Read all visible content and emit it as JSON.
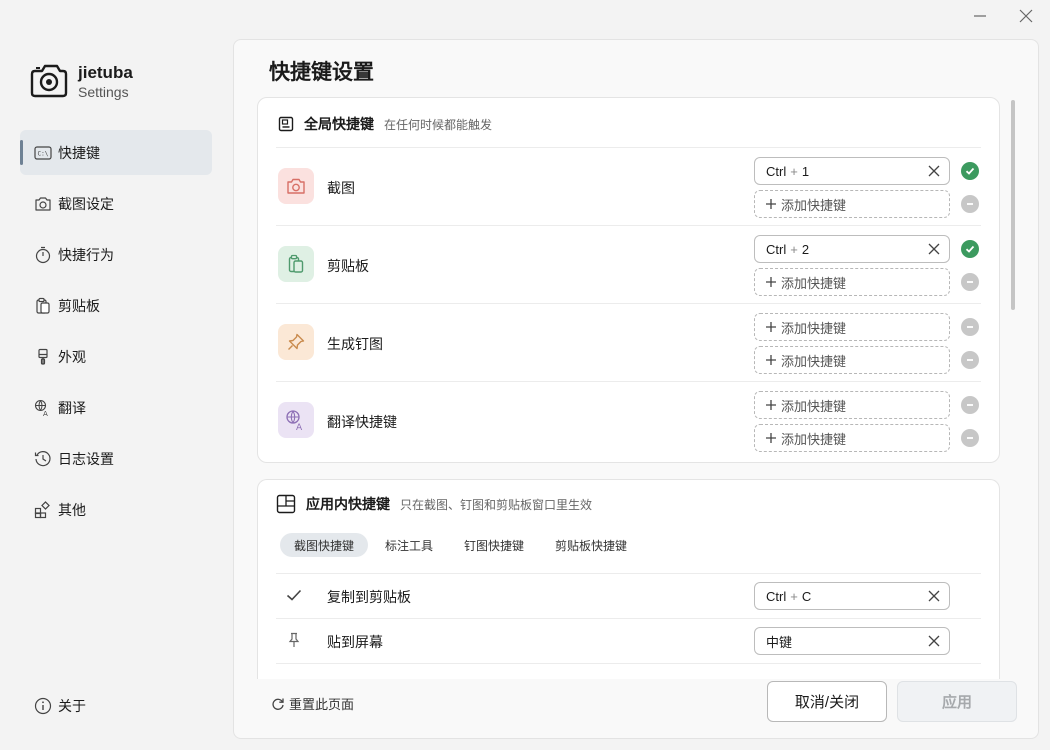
{
  "app": {
    "name": "jietuba",
    "subtitle": "Settings"
  },
  "sidebar": {
    "items": [
      {
        "label": "快捷键"
      },
      {
        "label": "截图设定"
      },
      {
        "label": "快捷行为"
      },
      {
        "label": "剪贴板"
      },
      {
        "label": "外观"
      },
      {
        "label": "翻译"
      },
      {
        "label": "日志设置"
      },
      {
        "label": "其他"
      }
    ],
    "active": "快捷键",
    "about": "关于"
  },
  "main": {
    "title": "快捷键设置",
    "global": {
      "title": "全局快捷键",
      "subtitle": "在任何时候都能触发",
      "rows": [
        {
          "label": "截图",
          "key1": {
            "mod": "Ctrl",
            "sep": "+",
            "key": "1"
          },
          "add2": "添加快捷键"
        },
        {
          "label": "剪贴板",
          "key1": {
            "mod": "Ctrl",
            "sep": "+",
            "key": "2"
          },
          "add2": "添加快捷键"
        },
        {
          "label": "生成钉图",
          "add1": "添加快捷键",
          "add2": "添加快捷键"
        },
        {
          "label": "翻译快捷键",
          "add1": "添加快捷键",
          "add2": "添加快捷键"
        }
      ]
    },
    "inapp": {
      "title": "应用内快捷键",
      "subtitle": "只在截图、钉图和剪贴板窗口里生效",
      "tabs": [
        "截图快捷键",
        "标注工具",
        "钉图快捷键",
        "剪贴板快捷键"
      ],
      "active_tab": "截图快捷键",
      "rows": [
        {
          "label": "复制到剪贴板",
          "mod": "Ctrl",
          "sep": "+",
          "key": "C"
        },
        {
          "label": "贴到屏幕",
          "key": "中键"
        }
      ]
    }
  },
  "footer": {
    "reset": "重置此页面",
    "cancel": "取消/关闭",
    "apply": "应用"
  },
  "colors": {
    "accent": "#6e8194",
    "ok": "#3c9a5f",
    "disabled": "#c7c7c7"
  }
}
